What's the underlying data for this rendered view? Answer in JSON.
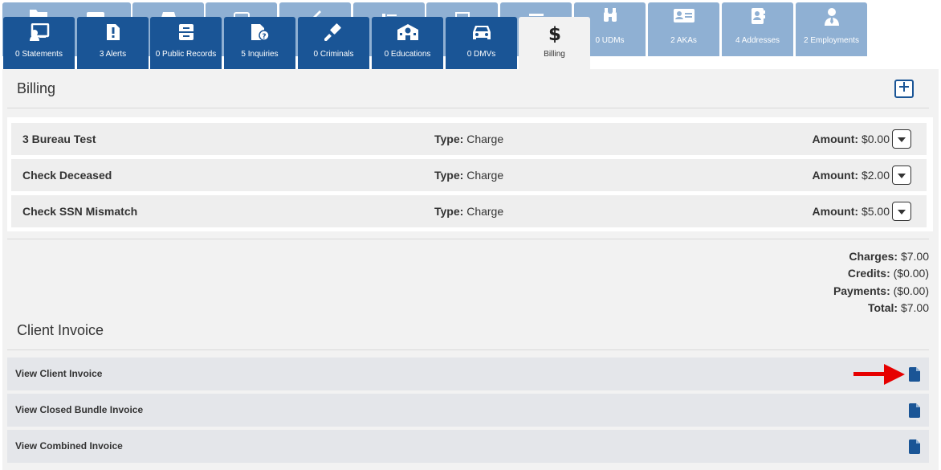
{
  "colors": {
    "tab_front": "#1a5596",
    "tab_back": "#8fb0d3",
    "panel_bg": "#f2f2f2",
    "arrow": "#e60000"
  },
  "tabs_back": [
    {
      "name": "folder-tab",
      "label": "",
      "icon": "folder-icon"
    },
    {
      "name": "inbox-tab",
      "label": "",
      "icon": "inbox-icon"
    },
    {
      "name": "box-tab",
      "label": "",
      "icon": "box-icon"
    },
    {
      "name": "cards-tab",
      "label": "",
      "icon": "cards-icon"
    },
    {
      "name": "tag-tab",
      "label": "",
      "icon": "tag-icon"
    },
    {
      "name": "list-tab",
      "label": "",
      "icon": "list-icon"
    },
    {
      "name": "id-tab",
      "label": "",
      "icon": "id-icon"
    },
    {
      "name": "table-tab",
      "label": "",
      "icon": "table-icon"
    },
    {
      "name": "udms-tab",
      "label": "0 UDMs",
      "icon": "binoculars-icon"
    },
    {
      "name": "akas-tab",
      "label": "2 AKAs",
      "icon": "id-card-icon"
    },
    {
      "name": "addresses-tab",
      "label": "4 Addresses",
      "icon": "address-book-icon"
    },
    {
      "name": "employments-tab",
      "label": "2 Employments",
      "icon": "user-tie-icon"
    }
  ],
  "tabs_front": [
    {
      "label": "0 Statements",
      "icon": "chalkboard-icon"
    },
    {
      "label": "3 Alerts",
      "icon": "alert-file-icon"
    },
    {
      "label": "0 Public Records",
      "icon": "file-cabinet-icon"
    },
    {
      "label": "5 Inquiries",
      "icon": "inquiry-file-icon"
    },
    {
      "label": "0 Criminals",
      "icon": "gavel-icon"
    },
    {
      "label": "0 Educations",
      "icon": "school-icon"
    },
    {
      "label": "0 DMVs",
      "icon": "car-icon"
    },
    {
      "label": "Billing",
      "icon": "dollar-icon"
    }
  ],
  "billing": {
    "title": "Billing",
    "charges": [
      {
        "name": "3 Bureau Test",
        "type_label": "Type:",
        "type": "Charge",
        "amount_label": "Amount:",
        "amount": "$0.00"
      },
      {
        "name": "Check Deceased",
        "type_label": "Type:",
        "type": "Charge",
        "amount_label": "Amount:",
        "amount": "$2.00"
      },
      {
        "name": "Check SSN Mismatch",
        "type_label": "Type:",
        "type": "Charge",
        "amount_label": "Amount:",
        "amount": "$5.00"
      }
    ],
    "totals": [
      {
        "label": "Charges:",
        "value": "$7.00"
      },
      {
        "label": "Credits:",
        "value": "($0.00)"
      },
      {
        "label": "Payments:",
        "value": "($0.00)"
      },
      {
        "label": "Total:",
        "value": "$7.00"
      }
    ]
  },
  "invoice": {
    "title": "Client Invoice",
    "rows": [
      {
        "label": "View Client Invoice"
      },
      {
        "label": "View Closed Bundle Invoice"
      },
      {
        "label": "View Combined Invoice"
      }
    ]
  }
}
